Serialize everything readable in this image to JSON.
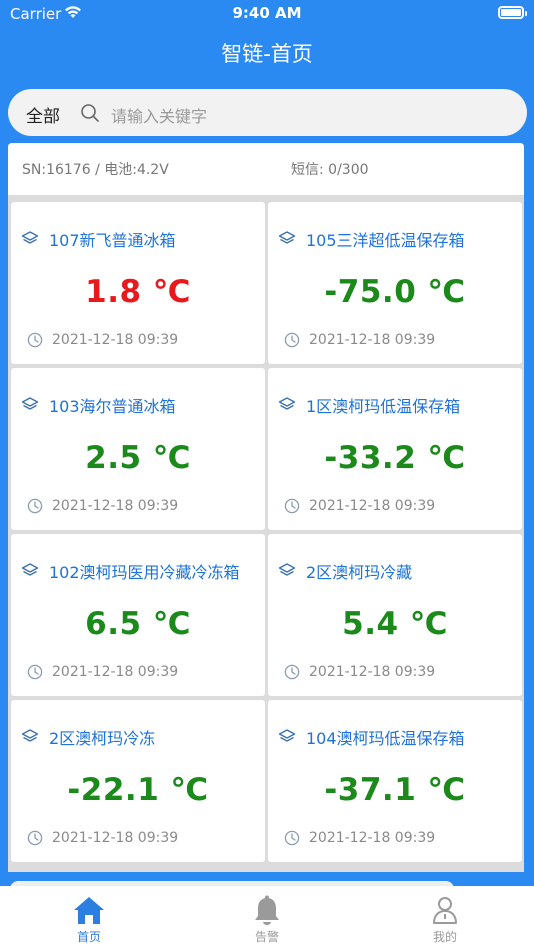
{
  "status_bar": {
    "carrier": "Carrier",
    "time": "9:40 AM"
  },
  "nav": {
    "title": "智链-首页"
  },
  "search": {
    "scope": "全部",
    "placeholder": "请输入关键字"
  },
  "device": {
    "sn_battery": "SN:16176 / 电池:4.2V",
    "sms": "短信: 0/300"
  },
  "colors": {
    "primary": "#2b8af2",
    "normal_temp": "#1b8a1b",
    "alarm_temp": "#e8191d",
    "name": "#1e73d8"
  },
  "cards": [
    {
      "name": "107新飞普通冰箱",
      "temp": "1.8 ℃",
      "time": "2021-12-18 09:39",
      "status": "alarm"
    },
    {
      "name": "105三洋超低温保存箱",
      "temp": "-75.0 ℃",
      "time": "2021-12-18 09:39",
      "status": "normal"
    },
    {
      "name": "103海尔普通冰箱",
      "temp": "2.5 ℃",
      "time": "2021-12-18 09:39",
      "status": "normal"
    },
    {
      "name": "1区澳柯玛低温保存箱",
      "temp": "-33.2 ℃",
      "time": "2021-12-18 09:39",
      "status": "normal"
    },
    {
      "name": "102澳柯玛医用冷藏冷冻箱",
      "temp": "6.5 ℃",
      "time": "2021-12-18 09:39",
      "status": "normal"
    },
    {
      "name": "2区澳柯玛冷藏",
      "temp": "5.4 ℃",
      "time": "2021-12-18 09:39",
      "status": "normal"
    },
    {
      "name": "2区澳柯玛冷冻",
      "temp": "-22.1 ℃",
      "time": "2021-12-18 09:39",
      "status": "normal"
    },
    {
      "name": "104澳柯玛低温保存箱",
      "temp": "-37.1 ℃",
      "time": "2021-12-18 09:39",
      "status": "normal"
    }
  ],
  "tabs": [
    {
      "label": "首页",
      "icon": "home-icon",
      "active": true
    },
    {
      "label": "告警",
      "icon": "bell-icon",
      "active": false
    },
    {
      "label": "我的",
      "icon": "user-icon",
      "active": false
    }
  ]
}
